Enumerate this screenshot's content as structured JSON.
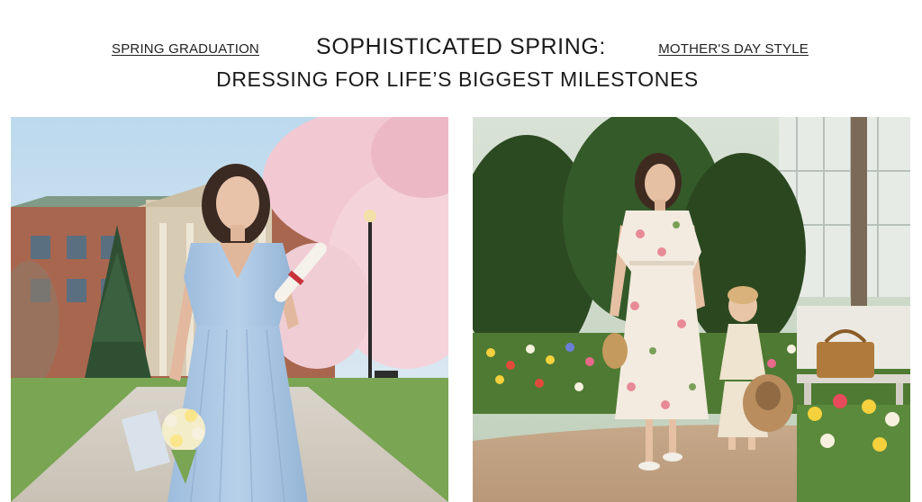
{
  "header": {
    "left_link": "SPRING GRADUATION",
    "right_link": "MOTHER'S DAY STYLE",
    "title_line1": "SOPHISTICATED SPRING:",
    "title_line2": "DRESSING FOR LIFE’S BIGGEST MILESTONES"
  },
  "photos": {
    "left": {
      "icon": "graduation-photo"
    },
    "right": {
      "icon": "mothers-day-photo"
    }
  },
  "colors": {
    "sky": "#cfe3f2",
    "blue_dress": "#a9c6e3",
    "blossom": "#f1c9d2",
    "grass": "#6fa04a",
    "floral_dress": "#f4ede2",
    "hedge": "#2f4a22"
  }
}
